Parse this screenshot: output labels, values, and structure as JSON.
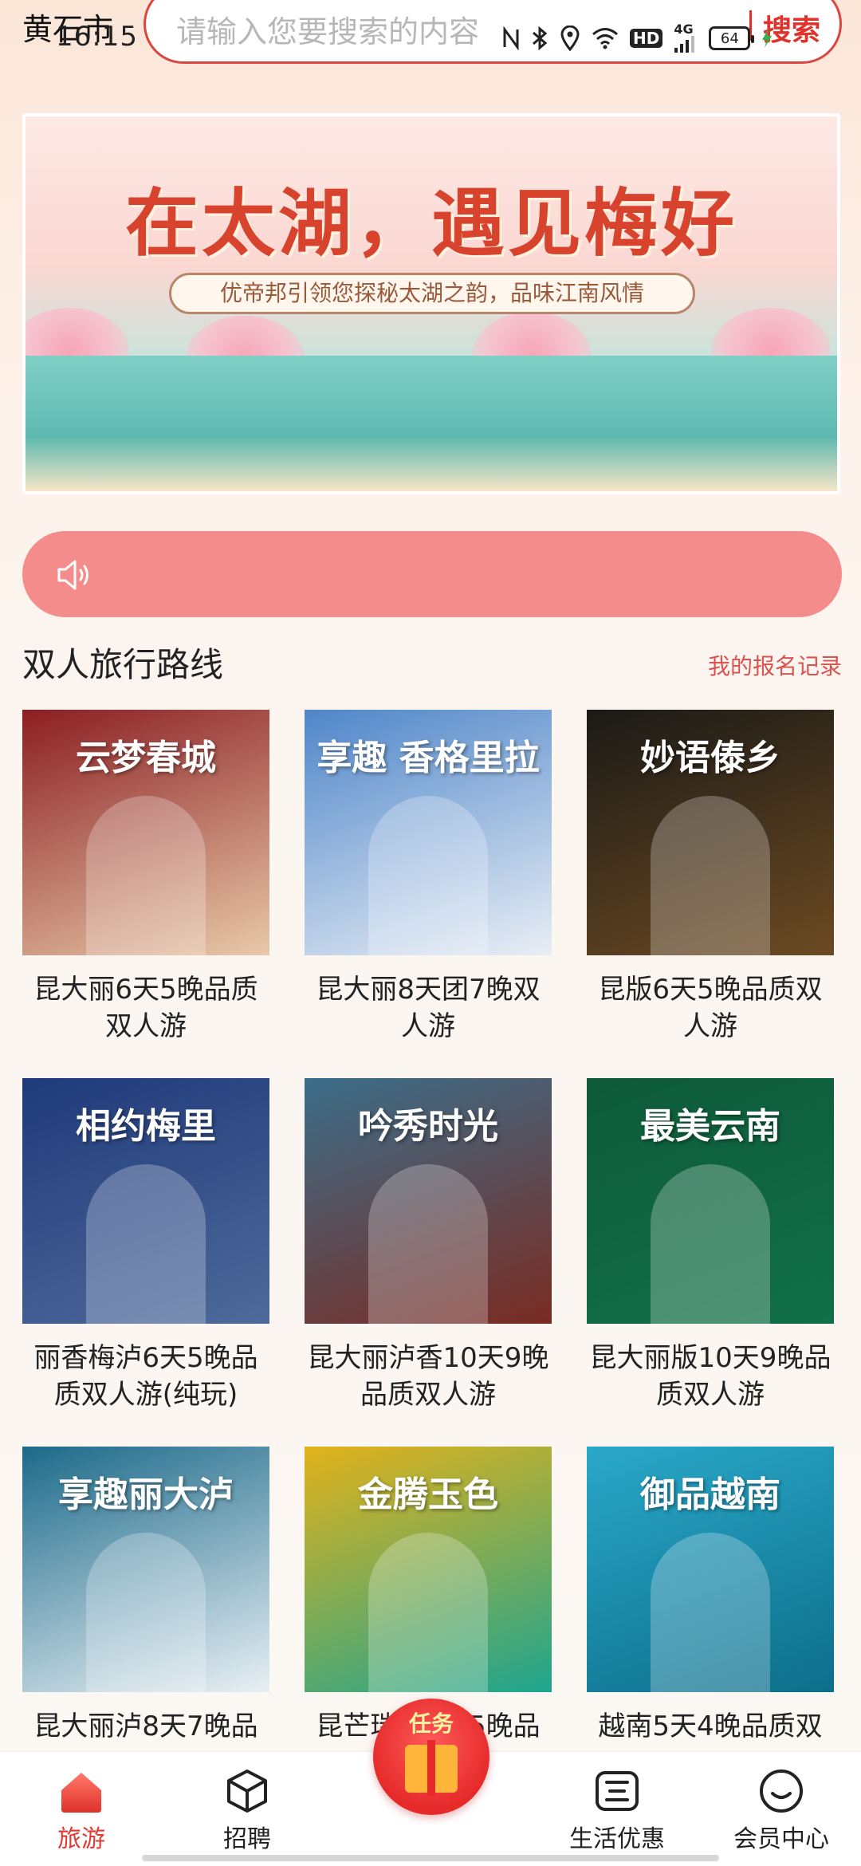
{
  "status_bar": {
    "time": "16:15",
    "nfc_icon": "nfc-icon",
    "hd_label": "HD",
    "network_label": "4G",
    "battery": "64"
  },
  "header": {
    "city": "黄石市",
    "search_placeholder": "请输入您要搜索的内容",
    "search_button": "搜索"
  },
  "banner": {
    "title": "在太湖，遇见梅好",
    "subtitle": "优帝邦引领您探秘太湖之韵，品味江南风情"
  },
  "notice": {
    "icon": "speaker-icon"
  },
  "section": {
    "title": "双人旅行路线",
    "records_link": "我的报名记录"
  },
  "routes": [
    {
      "title": "昆大丽6天5晚品质双人游",
      "poster_text": "云梦春城",
      "color_a": "#8b1e22",
      "color_b": "#e8c9a8"
    },
    {
      "title": "昆大丽8天团7晚双人游",
      "poster_text": "享趣 香格里拉",
      "color_a": "#4f86c9",
      "color_b": "#e9eef5"
    },
    {
      "title": "昆版6天5晚品质双人游",
      "poster_text": "妙语傣乡",
      "color_a": "#1b1a17",
      "color_b": "#6b4a22"
    },
    {
      "title": "丽香梅泸6天5晚品质双人游(纯玩)",
      "poster_text": "相约梅里",
      "color_a": "#1f3a7a",
      "color_b": "#4e6a9a"
    },
    {
      "title": "昆大丽泸香10天9晚品质双人游",
      "poster_text": "吟秀时光",
      "color_a": "#3b6e8a",
      "color_b": "#7a2b22"
    },
    {
      "title": "昆大丽版10天9晚品质双人游",
      "poster_text": "最美云南",
      "color_a": "#0e5a3a",
      "color_b": "#117048"
    },
    {
      "title": "昆大丽泸8天7晚品",
      "poster_text": "享趣丽大泸",
      "color_a": "#1c6a8a",
      "color_b": "#e9f0f4"
    },
    {
      "title": "昆芒瑞腾6天5晚品",
      "poster_text": "金腾玉色",
      "color_a": "#e3b21a",
      "color_b": "#1ea58f"
    },
    {
      "title": "越南5天4晚品质双",
      "poster_text": "御品越南",
      "color_a": "#2aa8c9",
      "color_b": "#0d6e8a"
    }
  ],
  "bottom_nav": {
    "items": [
      {
        "label": "旅游",
        "icon": "home-icon"
      },
      {
        "label": "招聘",
        "icon": "cube-icon"
      },
      {
        "label": "生活优惠",
        "icon": "coupon-icon"
      },
      {
        "label": "会员中心",
        "icon": "smile-icon"
      }
    ],
    "task_label": "任务",
    "accent": "#e03a33"
  }
}
